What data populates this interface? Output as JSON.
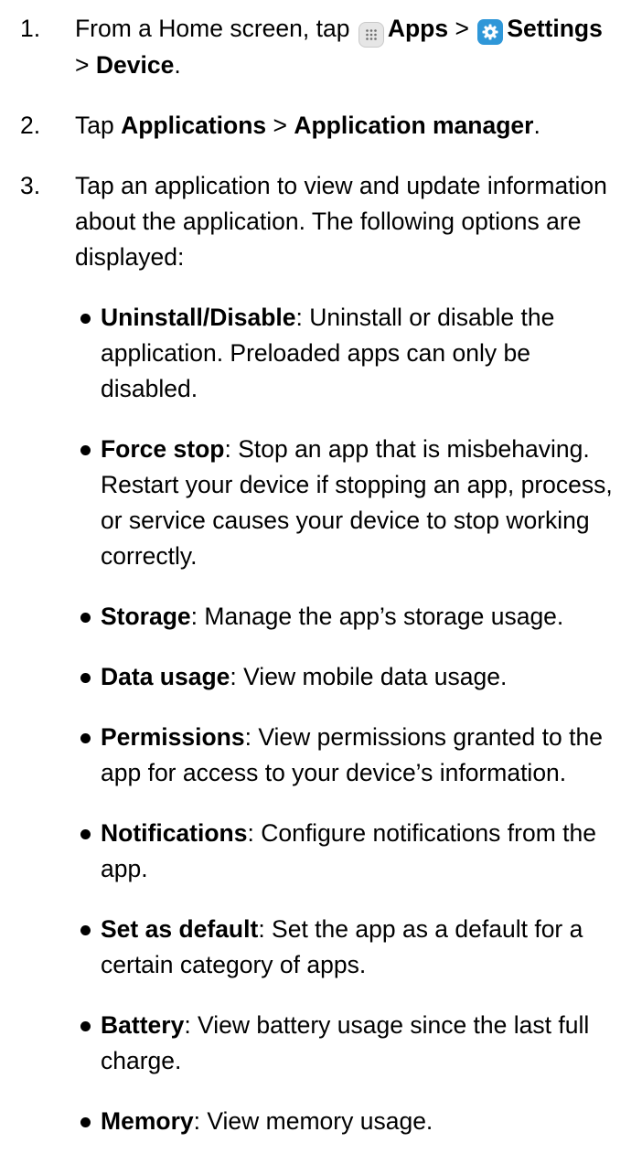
{
  "steps": [
    {
      "number": "1.",
      "parts": {
        "t1": "From a Home screen, tap",
        "apps_label": "Apps",
        "sep1": ">",
        "settings_label": "Settings",
        "sep2": ">",
        "device_label": "Device",
        "end": "."
      },
      "icons": [
        "apps-icon",
        "settings-gear-icon"
      ]
    },
    {
      "number": "2.",
      "parts": {
        "t1": "Tap",
        "applications_label": "Applications",
        "sep1": ">",
        "application_manager_label": "Application manager",
        "end": "."
      }
    },
    {
      "number": "3.",
      "text": "Tap an application to view and update information about the application. The following options are displayed:",
      "options": [
        {
          "term": "Uninstall/Disable",
          "desc": ": Uninstall or disable the application. Preloaded apps can only be disabled."
        },
        {
          "term": "Force stop",
          "desc": ": Stop an app that is misbehaving. Restart your device if stopping an app, process, or service causes your device to stop working correctly."
        },
        {
          "term": "Storage",
          "desc": ": Manage the app’s storage usage."
        },
        {
          "term": "Data usage",
          "desc": ": View mobile data usage."
        },
        {
          "term": "Permissions",
          "desc": ": View permissions granted to the app for access to your device’s information."
        },
        {
          "term": "Notifications",
          "desc": ": Configure notifications from the app."
        },
        {
          "term": "Set as default",
          "desc": ": Set the app as a default for a certain category of apps."
        },
        {
          "term": "Battery",
          "desc": ": View battery usage since the last full charge."
        },
        {
          "term": "Memory",
          "desc": ": View memory usage."
        }
      ]
    }
  ],
  "colors": {
    "text": "#000000",
    "settings_icon_bg": "#2f97d8",
    "apps_icon_bg": "#e6e6e6"
  }
}
